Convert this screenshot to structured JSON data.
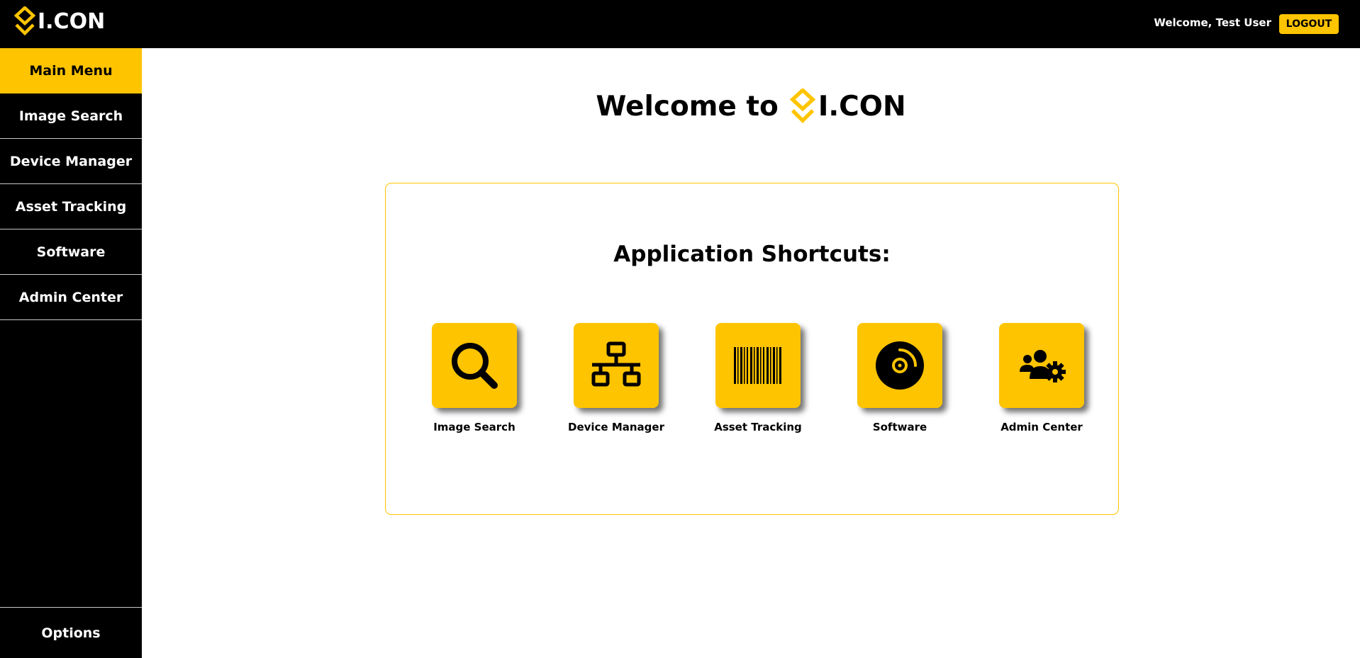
{
  "header": {
    "brand": "I.CON",
    "welcome": "Welcome, Test User",
    "logout_label": "LOGOUT"
  },
  "sidebar": {
    "items": [
      {
        "label": "Main Menu",
        "active": true
      },
      {
        "label": "Image Search"
      },
      {
        "label": "Device Manager"
      },
      {
        "label": "Asset Tracking"
      },
      {
        "label": "Software"
      },
      {
        "label": "Admin Center"
      }
    ],
    "options_label": "Options"
  },
  "main": {
    "welcome_prefix": "Welcome to",
    "welcome_brand": "I.CON",
    "panel_title": "Application Shortcuts:",
    "shortcuts": [
      {
        "label": "Image Search",
        "icon": "search-icon"
      },
      {
        "label": "Device Manager",
        "icon": "network-icon"
      },
      {
        "label": "Asset Tracking",
        "icon": "barcode-icon"
      },
      {
        "label": "Software",
        "icon": "disc-icon"
      },
      {
        "label": "Admin Center",
        "icon": "users-gear-icon"
      }
    ]
  },
  "colors": {
    "accent": "#ffc400",
    "nav_background": "#000000",
    "page_background": "#ffffff"
  }
}
